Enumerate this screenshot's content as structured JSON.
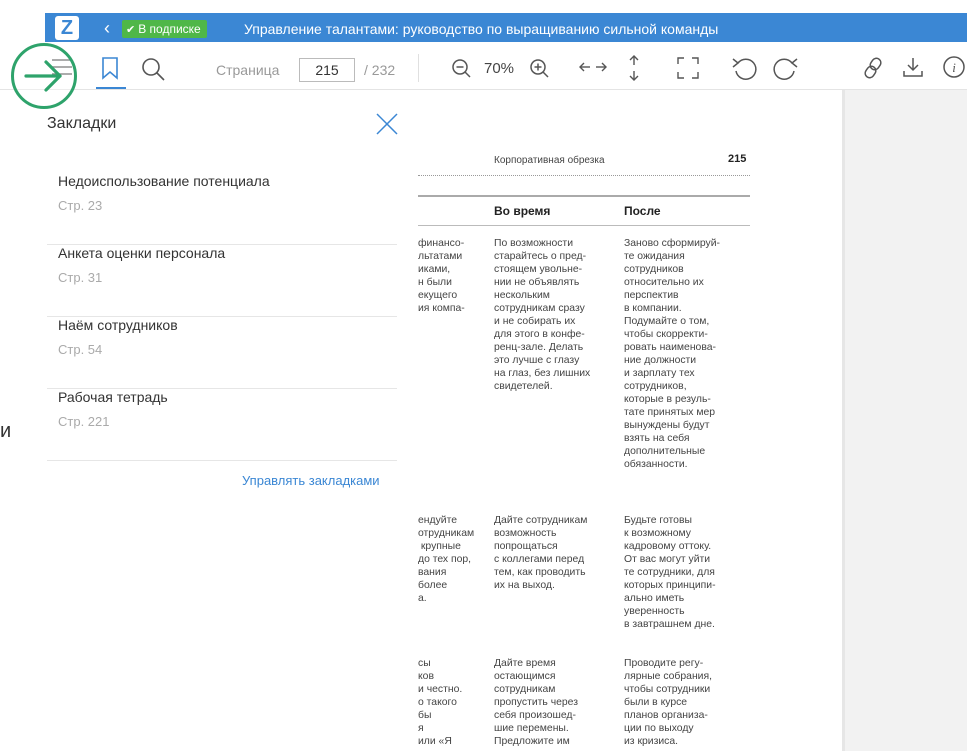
{
  "header": {
    "logo_letter": "Z",
    "back_glyph": "‹",
    "subscription_badge": "В подписке",
    "book_title": "Управление талантами: руководство по выращиванию сильной команды",
    "accent_color": "#3b87d4",
    "badge_color": "#4fb748"
  },
  "toolbar": {
    "page_label": "Страница",
    "page_value": "215",
    "page_total": "/ 232",
    "zoom_level": "70%"
  },
  "bookmarks": {
    "title": "Закладки",
    "items": [
      {
        "title": "Недоиспользование потенциала",
        "page": "Стр. 23"
      },
      {
        "title": "Анкета оценки персонала",
        "page": "Стр. 31"
      },
      {
        "title": "Наём сотрудников",
        "page": "Стр. 54"
      },
      {
        "title": "Рабочая тетрадь",
        "page": "Стр. 221"
      }
    ],
    "manage_label": "Управлять закладками"
  },
  "background": {
    "stray_letter": "и"
  },
  "book_page": {
    "running_head": "Корпоративная обрезка",
    "page_number": "215",
    "col_during": "Во время",
    "col_after": "После",
    "rows": [
      {
        "before": "финансо-\nльтатами\nиками,\nн были\nекущего\nия компа-",
        "during": "По возможности\nстарайтесь о пред-\nстоящем увольне-\nнии не объявлять\nнескольким\nсотрудникам сразу\nи не собирать их\nдля этого в конфе-\nренц-зале. Делать\nэто лучше с глазу\nна глаз, без лишних\nсвидетелей.",
        "after": "Заново сформируй-\nте ожидания\nсотрудников\nотносительно их\nперспектив\nв компании.\nПодумайте о том,\nчтобы скорректи-\nровать наименова-\nние должности\nи зарплату тех\nсотрудников,\nкоторые в резуль-\nтате принятых мер\nвынуждены будут\nвзять на себя\nдополнительные\nобязанности."
      },
      {
        "before": "ендуйте\nотрудникам\n крупные\nдо тех пор,\nвания\nболее\nа.",
        "during": "Дайте сотрудникам\nвозможность\nпопрощаться\nс коллегами перед\nтем, как проводить\nих на выход.",
        "after": "Будьте готовы\nк возможному\nкадровому оттоку.\nОт вас могут уйти\nте сотрудники, для\nкоторых принципи-\nально иметь\nуверенность\nв завтрашнем дне."
      },
      {
        "before": "сы\nков\nи честно.\nо такого\nбы\nя\nили «Я",
        "during": "Дайте время\nостающимся\nсотрудникам\nпропустить через\nсебя произошед-\nшие перемены.\nПредложите им",
        "after": "Проводите регу-\nлярные собрания,\nчтобы сотрудники\nбыли в курсе\nпланов организа-\nции по выходу\nиз кризиса."
      }
    ]
  }
}
